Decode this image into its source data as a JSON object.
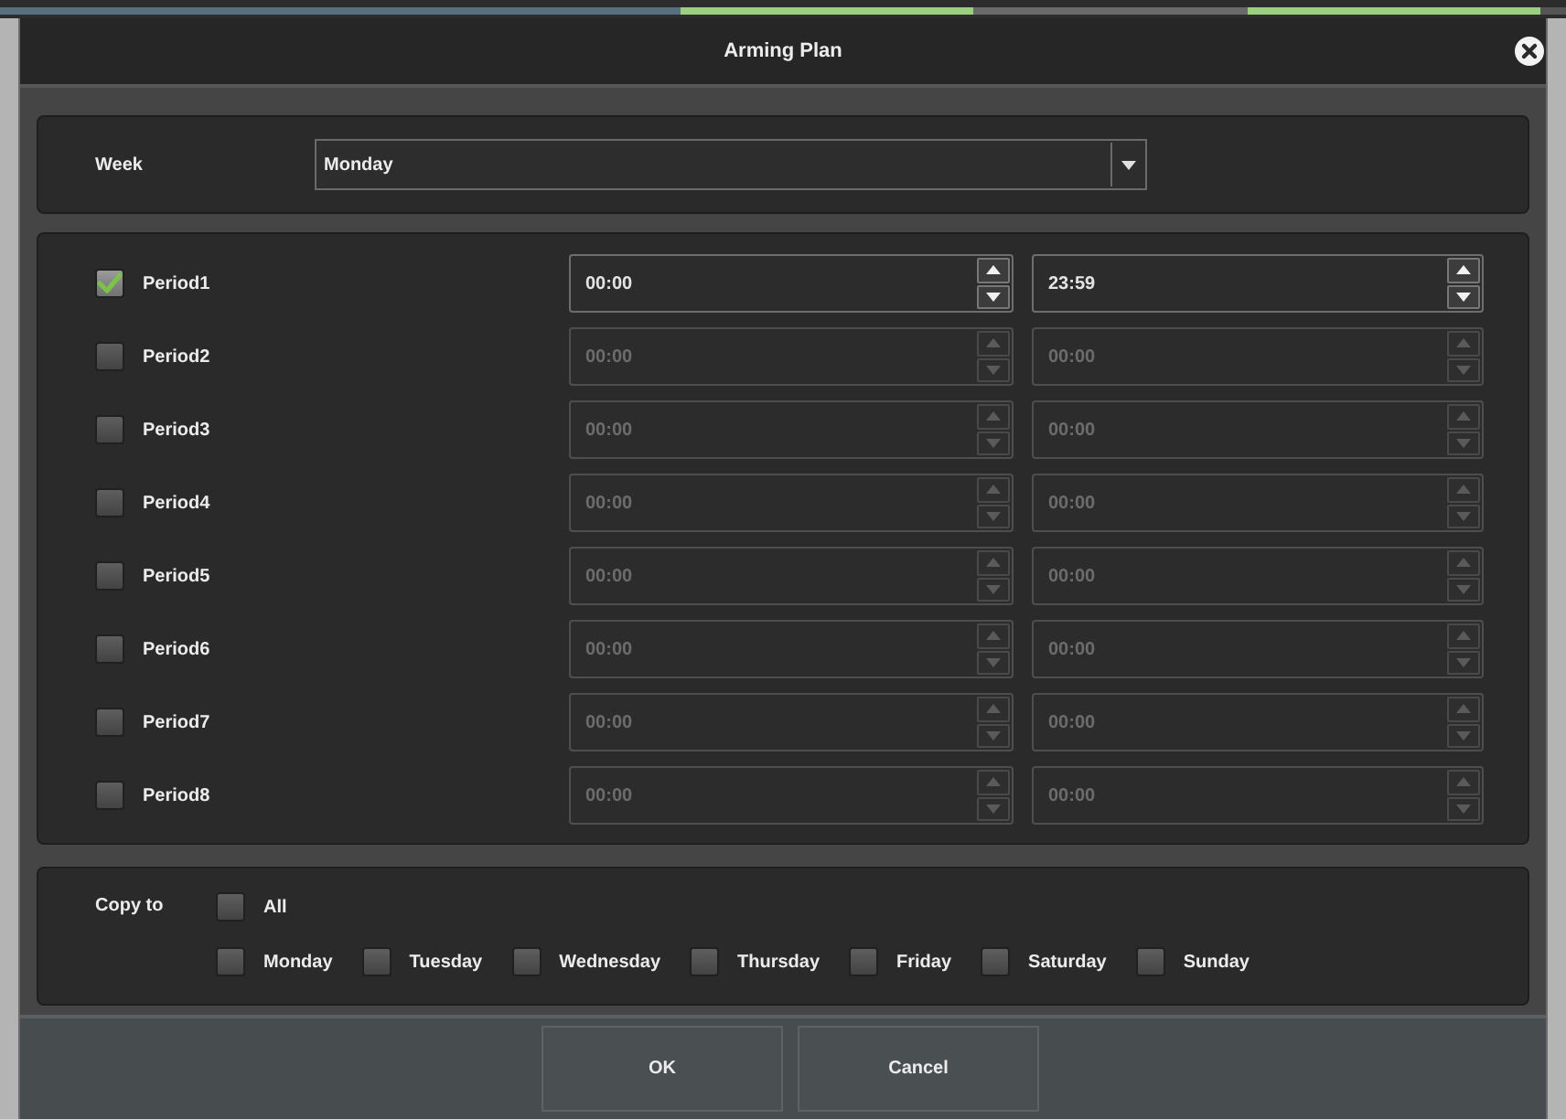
{
  "window": {
    "title": "Arming Plan"
  },
  "week": {
    "label": "Week",
    "value": "Monday"
  },
  "periods": [
    {
      "label": "Period1",
      "checked": true,
      "disabled": false,
      "start": "00:00",
      "end": "23:59"
    },
    {
      "label": "Period2",
      "checked": false,
      "disabled": true,
      "start": "00:00",
      "end": "00:00"
    },
    {
      "label": "Period3",
      "checked": false,
      "disabled": true,
      "start": "00:00",
      "end": "00:00"
    },
    {
      "label": "Period4",
      "checked": false,
      "disabled": true,
      "start": "00:00",
      "end": "00:00"
    },
    {
      "label": "Period5",
      "checked": false,
      "disabled": true,
      "start": "00:00",
      "end": "00:00"
    },
    {
      "label": "Period6",
      "checked": false,
      "disabled": true,
      "start": "00:00",
      "end": "00:00"
    },
    {
      "label": "Period7",
      "checked": false,
      "disabled": true,
      "start": "00:00",
      "end": "00:00"
    },
    {
      "label": "Period8",
      "checked": false,
      "disabled": true,
      "start": "00:00",
      "end": "00:00"
    }
  ],
  "copy_to": {
    "label": "Copy to",
    "all": {
      "label": "All",
      "checked": false
    },
    "days": [
      {
        "label": "Monday",
        "checked": false
      },
      {
        "label": "Tuesday",
        "checked": false
      },
      {
        "label": "Wednesday",
        "checked": false
      },
      {
        "label": "Thursday",
        "checked": false
      },
      {
        "label": "Friday",
        "checked": false
      },
      {
        "label": "Saturday",
        "checked": false
      },
      {
        "label": "Sunday",
        "checked": false
      }
    ]
  },
  "buttons": [
    "OK",
    "Cancel"
  ]
}
